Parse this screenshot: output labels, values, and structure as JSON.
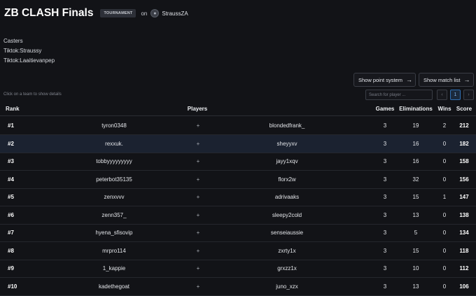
{
  "header": {
    "title": "ZB CLASH Finals",
    "badge": "TOURNAMENT",
    "on_text": "on",
    "owner": "StraussZA"
  },
  "description": [
    "Casters",
    "Tiktok:Straussy",
    "Tiktok:Laaitievanpep"
  ],
  "buttons": {
    "point_system": "Show point system",
    "match_list": "Show match list"
  },
  "hint": "Click on a team to show details",
  "search": {
    "placeholder": "Search for player ..."
  },
  "pagination": {
    "current_page": "1"
  },
  "table": {
    "headers": {
      "rank": "Rank",
      "players": "Players",
      "games": "Games",
      "eliminations": "Eliminations",
      "wins": "Wins",
      "score": "Score"
    },
    "rows": [
      {
        "rank": "#1",
        "player1": "tyron0348",
        "player2": "blondedfrank_",
        "games": "3",
        "eliminations": "19",
        "wins": "2",
        "score": "212"
      },
      {
        "rank": "#2",
        "player1": "rexxuk.",
        "player2": "sheyyxv",
        "games": "3",
        "eliminations": "16",
        "wins": "0",
        "score": "182"
      },
      {
        "rank": "#3",
        "player1": "tobbyyyyyyyyy",
        "player2": "jayy1xqv",
        "games": "3",
        "eliminations": "16",
        "wins": "0",
        "score": "158"
      },
      {
        "rank": "#4",
        "player1": "peterbot35135",
        "player2": "florx2w",
        "games": "3",
        "eliminations": "32",
        "wins": "0",
        "score": "156"
      },
      {
        "rank": "#5",
        "player1": "zenxvvv",
        "player2": "adrivaaks",
        "games": "3",
        "eliminations": "15",
        "wins": "1",
        "score": "147"
      },
      {
        "rank": "#6",
        "player1": "zenn357_",
        "player2": "sleepy2cold",
        "games": "3",
        "eliminations": "13",
        "wins": "0",
        "score": "138"
      },
      {
        "rank": "#7",
        "player1": "hyena_sfisovip",
        "player2": "senseiaussie",
        "games": "3",
        "eliminations": "5",
        "wins": "0",
        "score": "134"
      },
      {
        "rank": "#8",
        "player1": "mrpro114",
        "player2": "zxrty1x",
        "games": "3",
        "eliminations": "15",
        "wins": "0",
        "score": "118"
      },
      {
        "rank": "#9",
        "player1": "1_kappie",
        "player2": "grxzz1x",
        "games": "3",
        "eliminations": "10",
        "wins": "0",
        "score": "112"
      },
      {
        "rank": "#10",
        "player1": "kadethegoat",
        "player2": "juno_xzx",
        "games": "3",
        "eliminations": "13",
        "wins": "0",
        "score": "106"
      }
    ]
  }
}
